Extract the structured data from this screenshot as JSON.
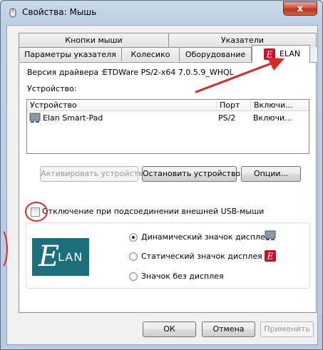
{
  "window": {
    "title": "Свойства: Мышь",
    "close_glyph": "x"
  },
  "tabs_row1": [
    {
      "label": "Кнопки мыши"
    },
    {
      "label": "Указатели"
    }
  ],
  "tabs_row2": [
    {
      "label": "Параметры указателя"
    },
    {
      "label": "Колесико"
    },
    {
      "label": "Оборудование"
    },
    {
      "label": "ELAN",
      "active": true
    }
  ],
  "driver": {
    "label": "Версия драйвера :",
    "value": "ETDWare PS/2-x64 7.0.5.9_WHQL"
  },
  "devices": {
    "label": "Устройство:",
    "columns": [
      "Устройство",
      "Порт",
      "Включи..."
    ],
    "rows": [
      {
        "name": "Elan Smart-Pad",
        "port": "PS/2",
        "enabled": "Включи..."
      }
    ]
  },
  "buttons": {
    "activate": "Активировать устройство",
    "stop": "Остановить устройство",
    "options": "Опции..."
  },
  "usb_checkbox": {
    "label": "Отключение при подсоединении внешней USB-мыши",
    "checked": false
  },
  "logo": {
    "text": "LAN",
    "letter": "E",
    "color": "#1a6f7a"
  },
  "display_icon": {
    "options": [
      {
        "label": "Динамический значок дисплея",
        "checked": true,
        "icon": "touchpad-icon"
      },
      {
        "label": "Статический значок дисплея",
        "checked": false,
        "icon": "elan-red-icon"
      },
      {
        "label": "Значок без дисплея",
        "checked": false
      }
    ]
  },
  "dialog_buttons": {
    "ok": "ОК",
    "cancel": "Отмена",
    "apply": "Применить"
  },
  "colors": {
    "annotation_red": "#d42a2a",
    "elan_red": "#c8102e",
    "logo_teal": "#1a6f7a"
  }
}
